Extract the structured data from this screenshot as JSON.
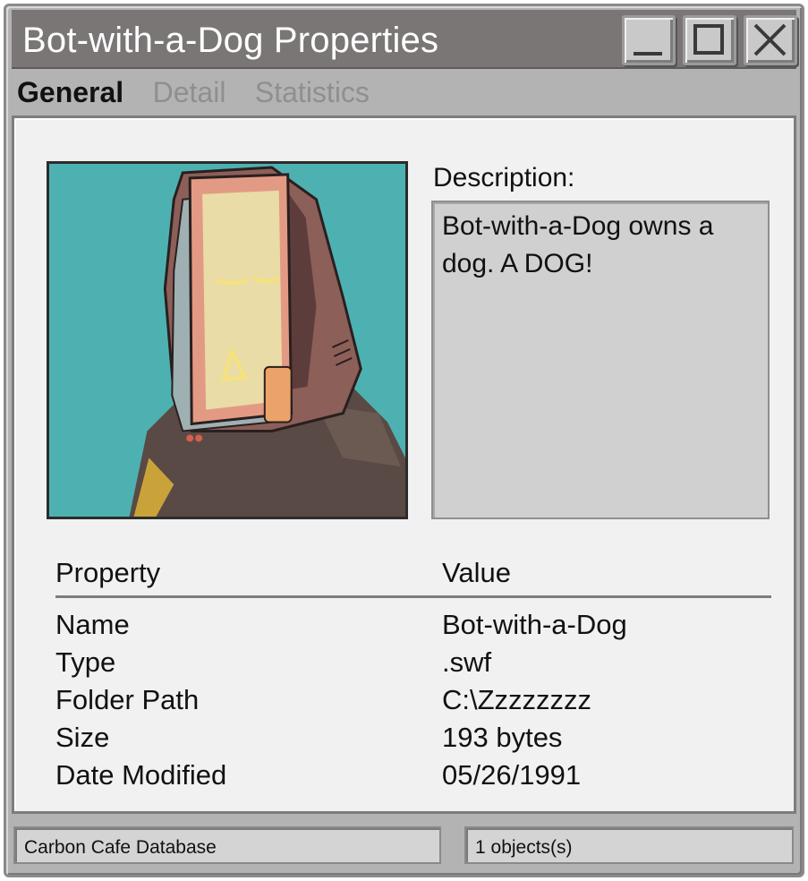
{
  "window": {
    "title": "Bot-with-a-Dog Properties",
    "controls": [
      "minimize-icon",
      "maximize-icon",
      "close-icon"
    ]
  },
  "tabs": [
    {
      "label": "General",
      "active": true
    },
    {
      "label": "Detail",
      "active": false
    },
    {
      "label": "Statistics",
      "active": false
    }
  ],
  "description": {
    "label": "Description:",
    "text": "Bot-with-a-Dog owns a dog. A DOG!"
  },
  "properties": {
    "headers": {
      "property": "Property",
      "value": "Value"
    },
    "rows": [
      {
        "property": "Name",
        "value": "Bot-with-a-Dog"
      },
      {
        "property": "Type",
        "value": ".swf"
      },
      {
        "property": "Folder Path",
        "value": "C:\\Zzzzzzzz"
      },
      {
        "property": "Size",
        "value": "193 bytes"
      },
      {
        "property": "Date Modified",
        "value": "05/26/1991"
      }
    ]
  },
  "status": {
    "left": "Carbon Cafe Database",
    "right": "1 objects(s)"
  },
  "colors": {
    "titlebar": "#7b7676",
    "portrait_background": "#4eb1b1",
    "panel": "#f1f1f1"
  }
}
